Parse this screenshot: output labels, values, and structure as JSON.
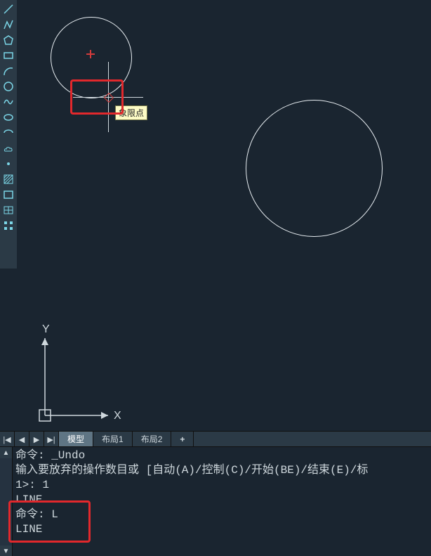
{
  "toolbar_icons": [
    "line",
    "polyline",
    "polygon",
    "rectangle",
    "arc",
    "circle",
    "spline",
    "ellipse",
    "revcloud",
    "point",
    "hatch",
    "region",
    "table",
    "grid"
  ],
  "tooltip": "象限点",
  "ucs": {
    "x_label": "X",
    "y_label": "Y"
  },
  "tabs": {
    "scroll_first": "|◀",
    "scroll_prev": "◀",
    "scroll_next": "▶",
    "scroll_last": "▶|",
    "model": "模型",
    "layout1": "布局1",
    "layout2": "布局2",
    "add": "+"
  },
  "command": {
    "line1": "命令: _Undo",
    "line2": "输入要放弃的操作数目或 [自动(A)/控制(C)/开始(BE)/结束(E)/标",
    "line3": "1>: 1",
    "line4": "LINE",
    "line5": "命令: L",
    "line6": "LINE"
  },
  "colors": {
    "accent": "#e2282c",
    "stroke": "#e8eef2",
    "icon": "#7bd5e6"
  }
}
